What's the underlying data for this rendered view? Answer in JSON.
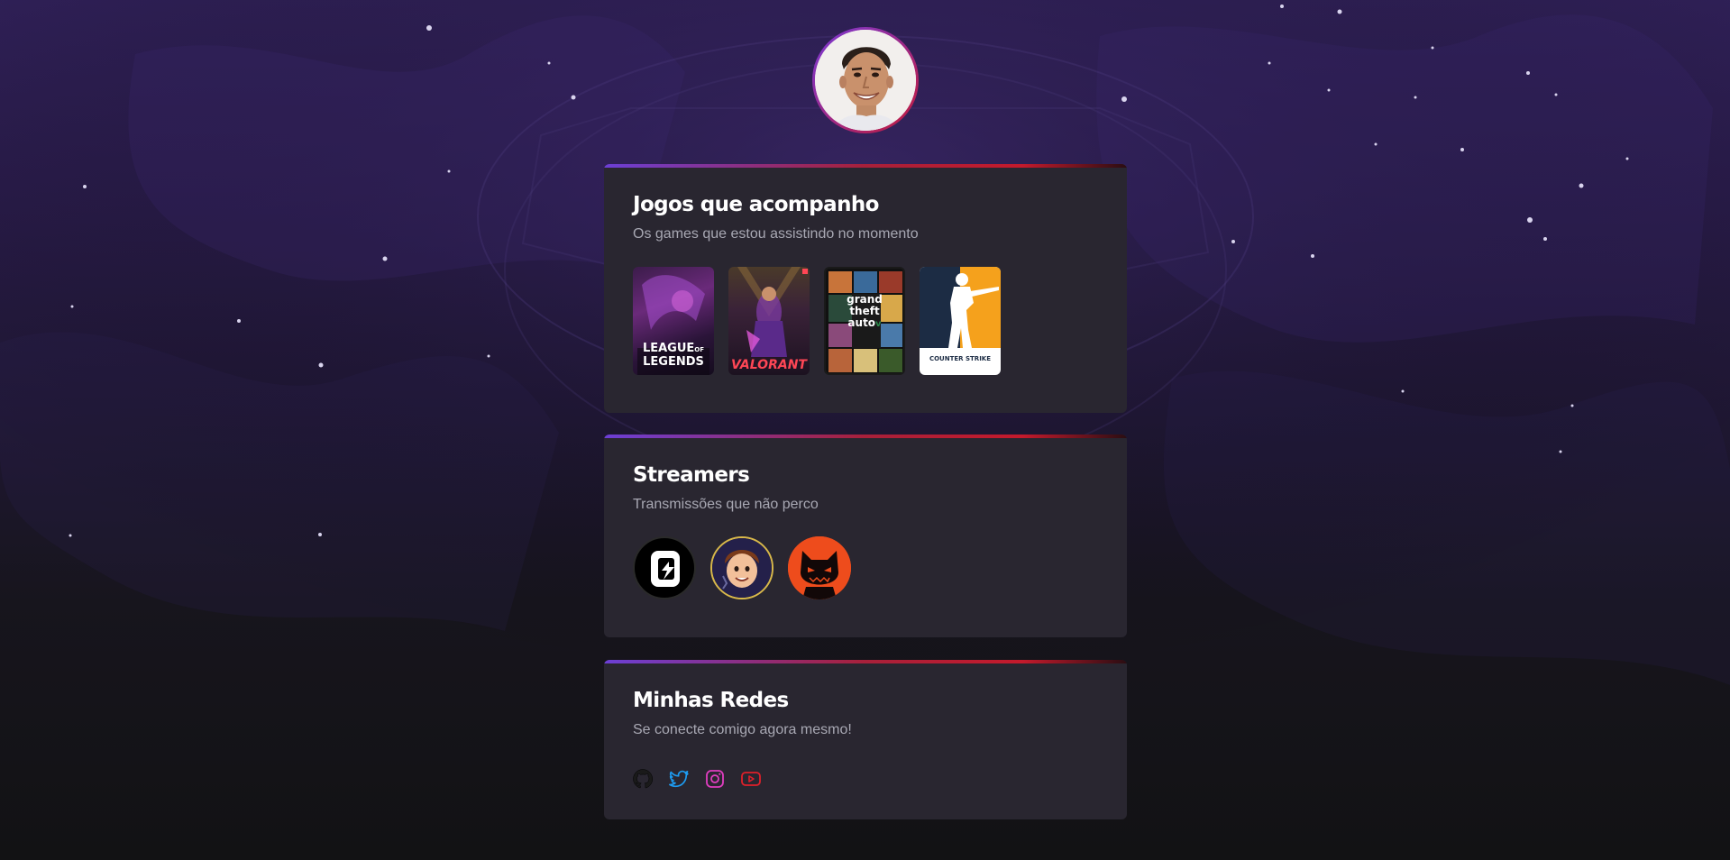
{
  "profile": {
    "avatar_icon": "profile-photo"
  },
  "games_card": {
    "title": "Jogos que acompanho",
    "subtitle": "Os games que estou assistindo no momento",
    "games": [
      {
        "name": "LEAGUE OF LEGENDS",
        "line1": "LEAGUE",
        "of": "OF",
        "line2": "LEGENDS"
      },
      {
        "name": "VALORANT",
        "line1": "VALORANT"
      },
      {
        "name": "Grand Theft Auto V",
        "line1": "grand",
        "line2": "theft",
        "line3": "auto",
        "line4": "V"
      },
      {
        "name": "Counter Strike",
        "line1": "COUNTER",
        "line2": "STRIKE"
      }
    ]
  },
  "streamers_card": {
    "title": "Streamers",
    "subtitle": "Transmissões que não perco",
    "streamers": [
      {
        "icon": "streamer-logo-c"
      },
      {
        "icon": "streamer-cartoon-avatar"
      },
      {
        "icon": "streamer-cat-mask"
      }
    ]
  },
  "social_card": {
    "title": "Minhas Redes",
    "subtitle": "Se conecte comigo agora mesmo!",
    "links": [
      {
        "icon": "github-icon",
        "color": "#1f1f1f"
      },
      {
        "icon": "twitter-icon",
        "color": "#1d9bf0"
      },
      {
        "icon": "instagram-icon",
        "color": "#e03ec0"
      },
      {
        "icon": "youtube-icon",
        "color": "#e0202a"
      }
    ]
  },
  "colors": {
    "accent_purple": "#6c3fd6",
    "accent_red": "#c41a2c",
    "card_bg": "#292630",
    "text_muted": "#a8a8b3"
  }
}
